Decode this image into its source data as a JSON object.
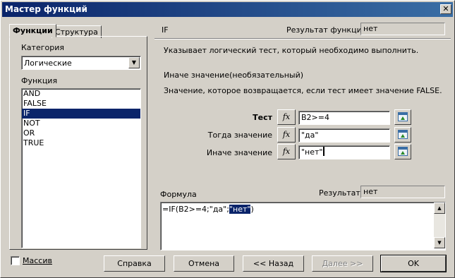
{
  "window": {
    "title": "Мастер функций",
    "close_glyph": "✕"
  },
  "tabs": [
    {
      "label": "Функции"
    },
    {
      "label": "Структура"
    }
  ],
  "category": {
    "label": "Категория",
    "value": "Логические"
  },
  "functions": {
    "label": "Функция",
    "items": [
      "AND",
      "FALSE",
      "IF",
      "NOT",
      "OR",
      "TRUE"
    ],
    "selected": "IF"
  },
  "function_info": {
    "name": "IF",
    "result_label": "Результат функции",
    "result_value": "нет",
    "description": "Указывает логический тест, который необходимо выполнить.",
    "arg_title": "Иначе значение(необязательный)",
    "arg_description": "Значение, которое возвращается, если тест имеет значение FALSE."
  },
  "arguments": [
    {
      "label": "Тест",
      "value": "B2>=4",
      "bold": true
    },
    {
      "label": "Тогда значение",
      "value": "\"да\""
    },
    {
      "label": "Иначе значение",
      "value": "\"нет\""
    }
  ],
  "fx_label": "fx",
  "formula": {
    "label": "Формула",
    "result_label": "Результат",
    "result_value": "нет",
    "text_before": "=IF(B2>=4;\"да\";",
    "text_selected": "\"нет\"",
    "text_after": ")"
  },
  "array_checkbox": {
    "label": "Массив",
    "checked": false
  },
  "buttons": {
    "help": "Справка",
    "cancel": "Отмена",
    "back": "<< Назад",
    "next": "Далее >>",
    "ok": "OK"
  }
}
